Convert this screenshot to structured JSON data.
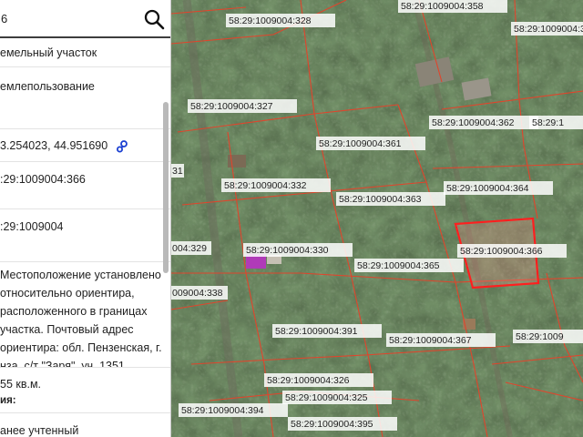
{
  "search": {
    "value": "6"
  },
  "panel": {
    "land_type": "емельный участок",
    "usage": "емлепользование",
    "coords": "3.254023, 44.951690",
    "cadastral_number": ":29:1009004:366",
    "quarter": ":29:1009004",
    "location_lines": [
      "Местоположение установлено",
      "относительно ориентира,",
      "расположенного в границах",
      "участка. Почтовый адрес",
      "ориентира: обл. Пензенская, г.",
      "нза, с/т \"Заря\", уч. 1351."
    ],
    "area": "55 кв.м.",
    "area_label_tail": "ия:",
    "status": "анее учтенный"
  },
  "map": {
    "labels": [
      {
        "id": "328",
        "text": "58:29:1009004:328"
      },
      {
        "id": "358",
        "text": "58:29:1009004:358"
      },
      {
        "id": "359",
        "text": "58:29:1009004:359"
      },
      {
        "id": "327",
        "text": "58:29:1009004:327"
      },
      {
        "id": "362",
        "text": "58:29:1009004:362"
      },
      {
        "id": "cut1",
        "text": "58:29:1"
      },
      {
        "id": "361",
        "text": "58:29:1009004:361"
      },
      {
        "id": "31",
        "text": "31"
      },
      {
        "id": "332",
        "text": "58:29:1009004:332"
      },
      {
        "id": "364",
        "text": "58:29:1009004:364"
      },
      {
        "id": "363",
        "text": "58:29:1009004:363"
      },
      {
        "id": "329",
        "text": "004:329"
      },
      {
        "id": "330",
        "text": "58:29:1009004:330"
      },
      {
        "id": "366",
        "text": "58:29:1009004:366"
      },
      {
        "id": "365",
        "text": "58:29:1009004:365"
      },
      {
        "id": "338",
        "text": "009004:338"
      },
      {
        "id": "391",
        "text": "58:29:1009004:391"
      },
      {
        "id": "cut2",
        "text": "58:29:1009"
      },
      {
        "id": "367",
        "text": "58:29:1009004:367"
      },
      {
        "id": "326",
        "text": "58:29:1009004:326"
      },
      {
        "id": "325",
        "text": "58:29:1009004:325"
      },
      {
        "id": "394",
        "text": "58:29:1009004:394"
      },
      {
        "id": "395",
        "text": "58:29:1009004:395"
      }
    ],
    "colors": {
      "boundary": "#e0452c",
      "selected": "#ff1f1f",
      "foliage_dark": "#1f2f1a",
      "foliage_light": "#4a5f3a"
    }
  }
}
